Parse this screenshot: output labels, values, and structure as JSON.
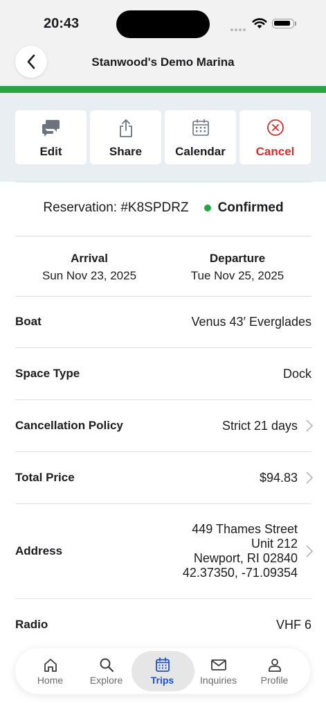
{
  "status_bar": {
    "time": "20:43"
  },
  "header": {
    "title": "Stanwood's Demo Marina",
    "accent_color": "#27a444"
  },
  "actions": [
    {
      "label": "Edit",
      "icon": "chat-bubbles-icon"
    },
    {
      "label": "Share",
      "icon": "share-icon"
    },
    {
      "label": "Calendar",
      "icon": "calendar-icon"
    },
    {
      "label": "Cancel",
      "icon": "cancel-circle-icon",
      "color": "#d32f2f"
    }
  ],
  "reservation": {
    "label": "Reservation: #K8SPDRZ",
    "status": "Confirmed",
    "status_color": "#27a444"
  },
  "dates": {
    "arrival_label": "Arrival",
    "arrival_value": "Sun Nov 23, 2025",
    "departure_label": "Departure",
    "departure_value": "Tue Nov 25, 2025"
  },
  "details": [
    {
      "label": "Boat",
      "value": "Venus 43′ Everglades"
    },
    {
      "label": "Space Type",
      "value": "Dock"
    },
    {
      "label": "Cancellation Policy",
      "value": "Strict 21 days"
    },
    {
      "label": "Total Price",
      "value": "$94.83"
    },
    {
      "label": "Address",
      "lines": [
        "449 Thames Street",
        "Unit 212",
        "Newport, RI 02840",
        "42.37350, -71.09354"
      ]
    },
    {
      "label": "Radio",
      "value": "VHF 6"
    }
  ],
  "tabs": [
    {
      "label": "Home",
      "icon": "home-icon"
    },
    {
      "label": "Explore",
      "icon": "search-icon"
    },
    {
      "label": "Trips",
      "icon": "calendar-icon",
      "active": true
    },
    {
      "label": "Inquiries",
      "icon": "mail-icon"
    },
    {
      "label": "Profile",
      "icon": "person-icon"
    }
  ]
}
